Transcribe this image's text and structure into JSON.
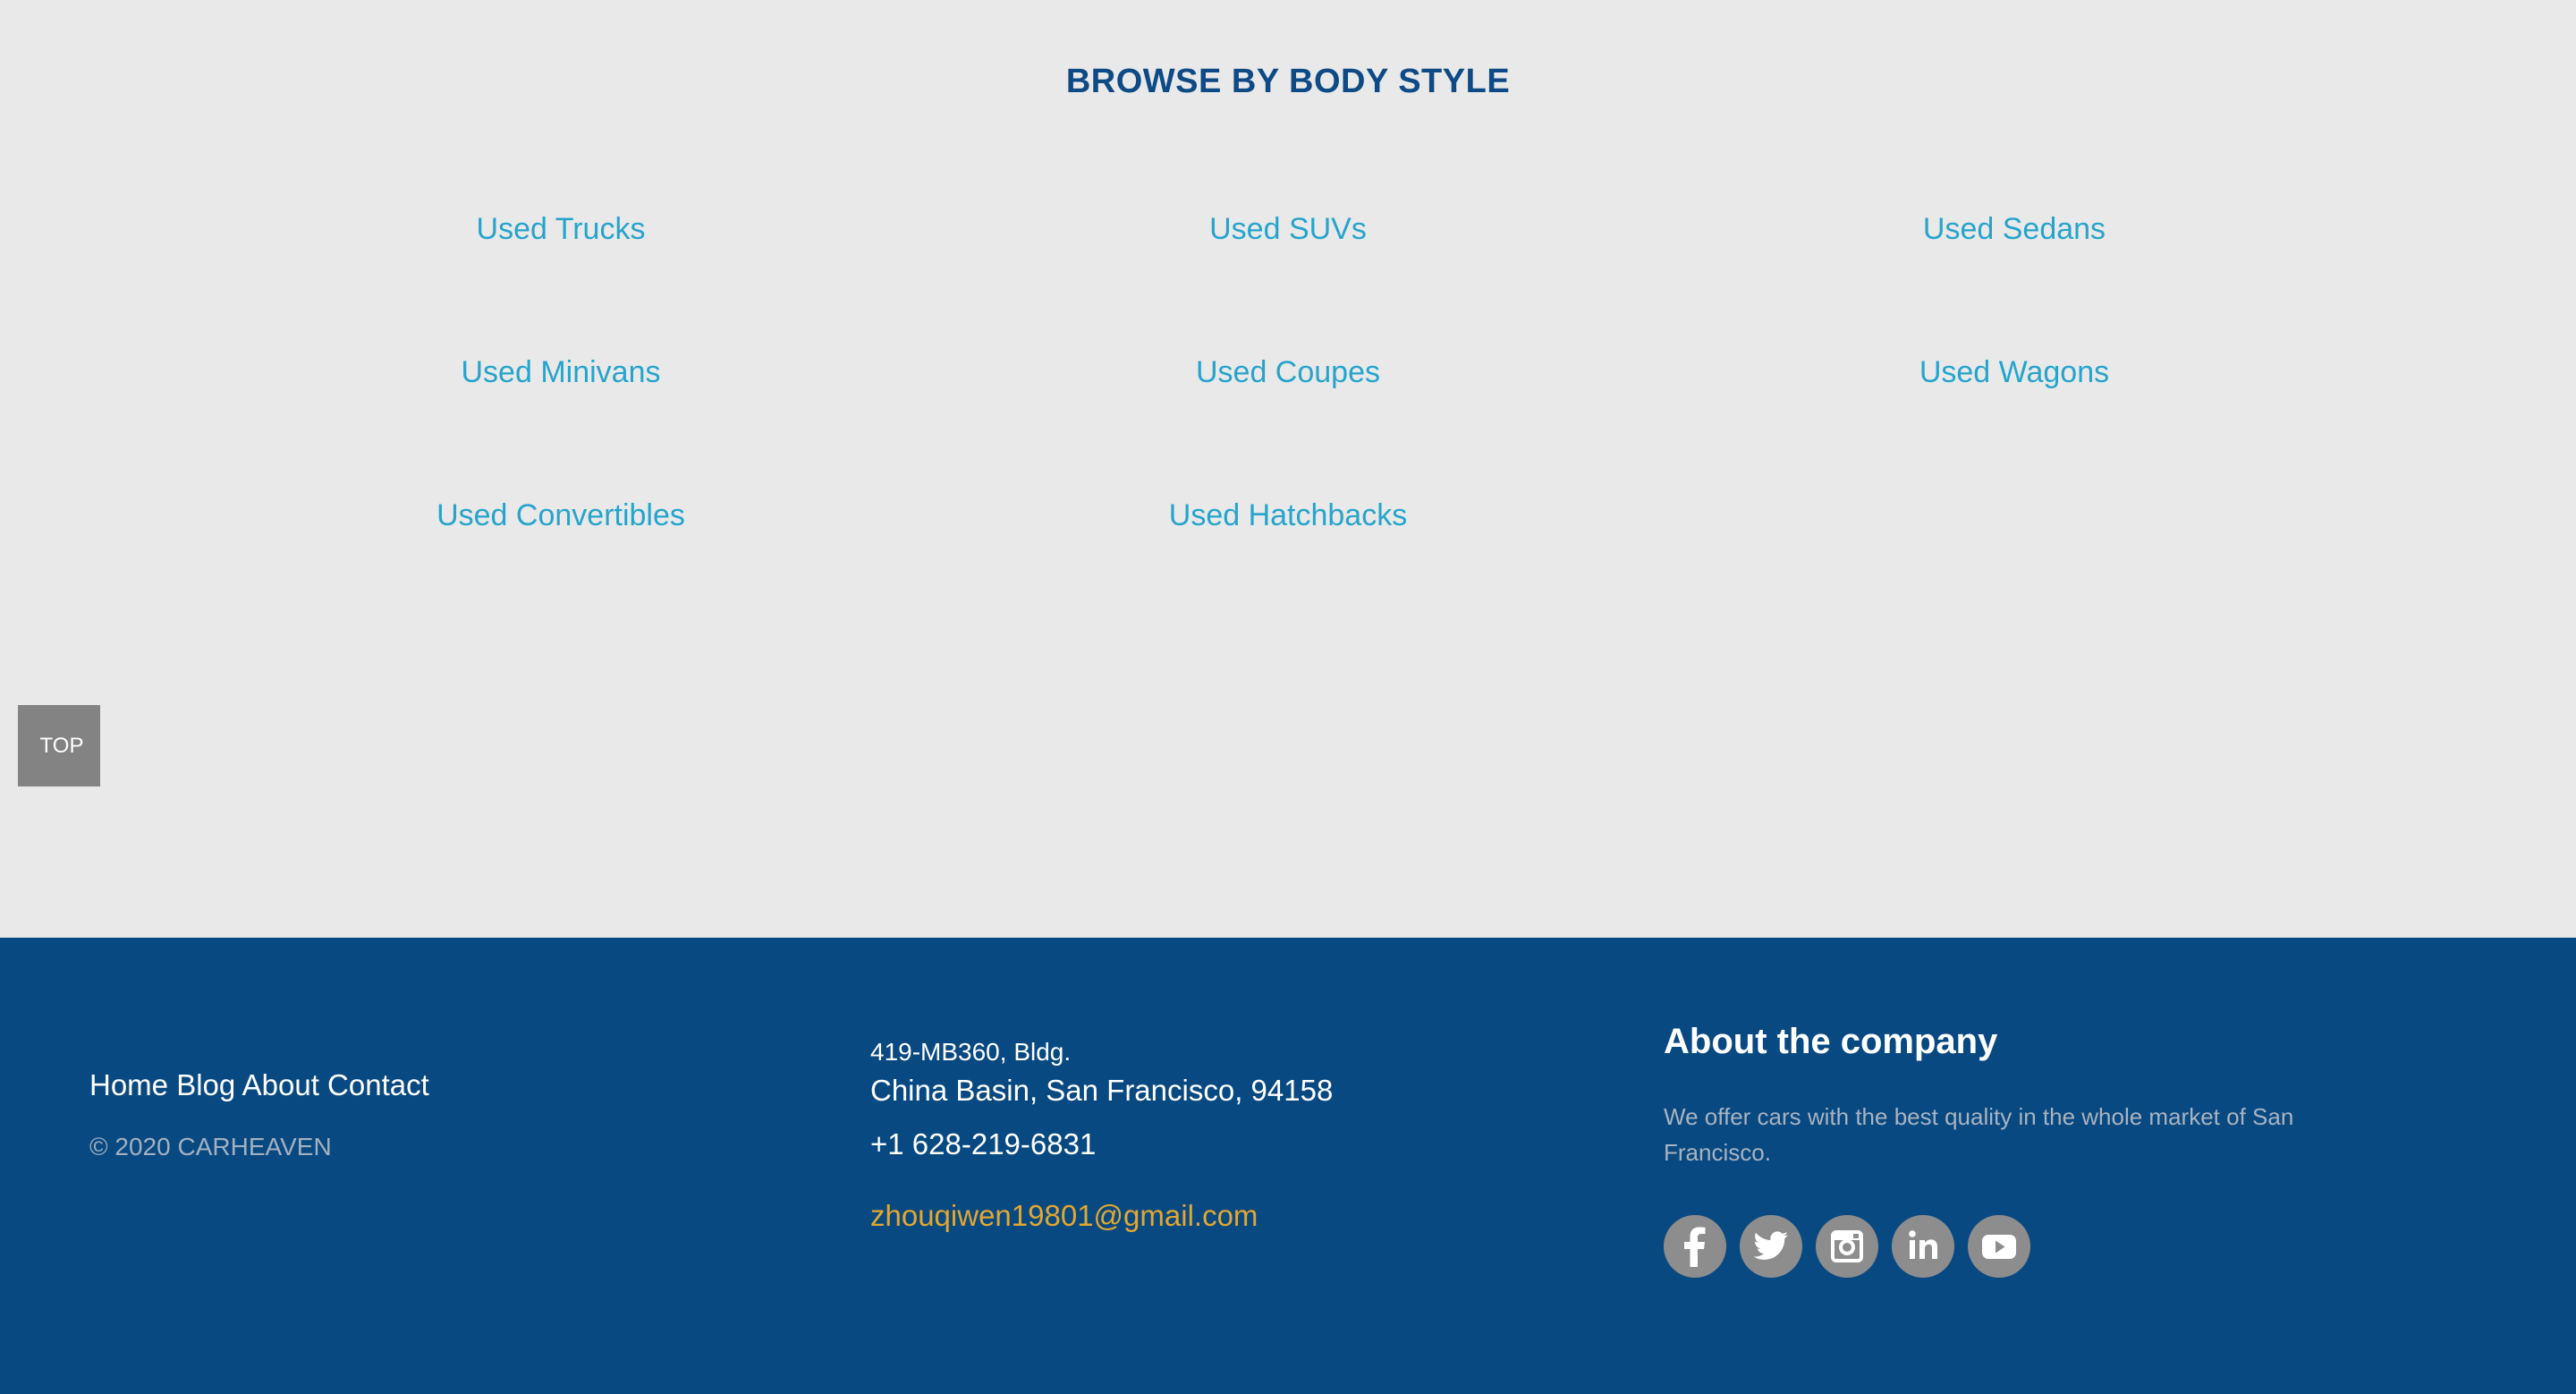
{
  "browse": {
    "title": "BROWSE BY BODY STYLE",
    "links": [
      "Used Trucks",
      "Used SUVs",
      "Used Sedans",
      "Used Minivans",
      "Used Coupes",
      "Used Wagons",
      "Used Convertibles",
      "Used Hatchbacks"
    ]
  },
  "top_button": {
    "label": "TOP"
  },
  "footer": {
    "nav": [
      "Home",
      "Blog",
      "About",
      "Contact"
    ],
    "copyright": "© 2020 CARHEAVEN",
    "address_line1": "419-MB360, Bldg.",
    "address_line2": "China Basin, San Francisco, 94158",
    "phone": "+1 628-219-6831",
    "email": "zhouqiwen19801@gmail.com",
    "about_title": "About the company",
    "about_text": "We offer cars with the best quality in the whole market of San Francisco.",
    "social_icons": [
      "facebook-icon",
      "twitter-icon",
      "instagram-icon",
      "linkedin-icon",
      "youtube-icon"
    ]
  },
  "colors": {
    "heading_blue": "#0d4a86",
    "link_cyan": "#26a4cc",
    "footer_bg": "#084982",
    "email_gold": "#e3a72f",
    "page_bg": "#e9e9e9",
    "top_button_bg": "#838383",
    "social_icon_bg": "#8d8d8d"
  }
}
